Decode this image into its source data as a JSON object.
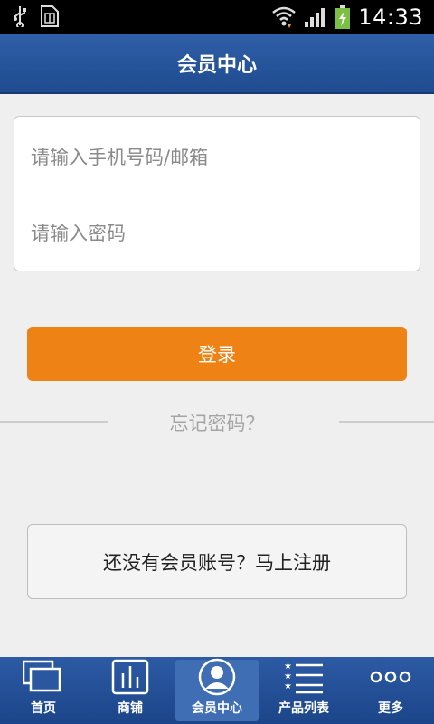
{
  "status_bar": {
    "time": "14:33",
    "icons": [
      "usb-icon",
      "sim-card-icon",
      "wifi-icon",
      "signal-icon",
      "battery-charging-icon"
    ]
  },
  "header": {
    "title": "会员中心"
  },
  "login_form": {
    "account_placeholder": "请输入手机号码/邮箱",
    "password_placeholder": "请输入密码",
    "login_label": "登录"
  },
  "forgot_label": "忘记密码？",
  "register_label": "还没有会员账号？马上注册",
  "bottom_nav": {
    "items": [
      {
        "label": "首页",
        "icon": "home-windows-icon"
      },
      {
        "label": "商铺",
        "icon": "shop-bars-icon"
      },
      {
        "label": "会员中心",
        "icon": "member-avatar-icon"
      },
      {
        "label": "产品列表",
        "icon": "product-list-icon"
      },
      {
        "label": "更多",
        "icon": "more-dots-icon"
      }
    ],
    "active_index": 2
  },
  "colors": {
    "header_blue": "#2f5fa8",
    "login_orange": "#ef8214",
    "background": "#efefef"
  }
}
